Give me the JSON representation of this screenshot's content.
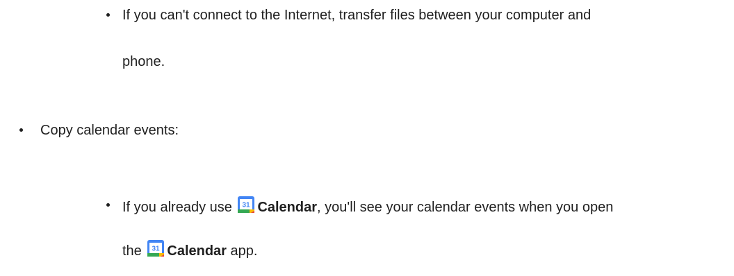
{
  "items": {
    "offline_tip": {
      "line1": "If you can't connect to the Internet, transfer files between your computer and",
      "line2": "phone."
    },
    "calendar_heading": "Copy calendar events:",
    "calendar_tip": {
      "pre1": "If you already use",
      "app1": "Calendar",
      "post1": ", you'll see your calendar events when you open",
      "pre2": "the",
      "app2": "Calendar",
      "post2": " app."
    },
    "icon": {
      "name": "google-calendar-icon",
      "day": "31",
      "colors": {
        "blue": "#4285F4",
        "green": "#34A853",
        "yellow": "#FBBC04",
        "red": "#EA4335"
      }
    }
  }
}
